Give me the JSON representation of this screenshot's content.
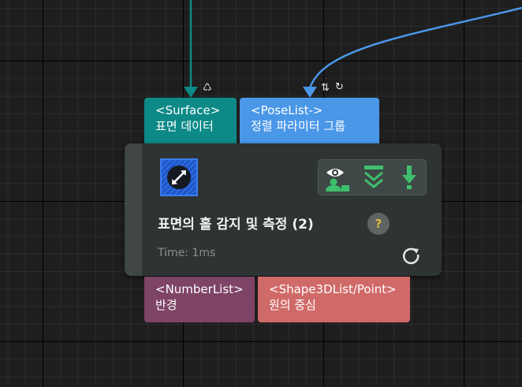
{
  "inputs": [
    {
      "type_tag": "<Surface>",
      "label": "표면 데이터",
      "color": "#0d8a87"
    },
    {
      "type_tag": "<PoseList->",
      "label": "정렬 파라미터 그룹",
      "color": "#4a97e8"
    }
  ],
  "outputs": [
    {
      "type_tag": "<NumberList>",
      "label": "반경",
      "color": "#7e4466"
    },
    {
      "type_tag": "<Shape3DList/Point>",
      "label": "원의 중심",
      "color": "#d06a68"
    }
  ],
  "port_icons": {
    "surface": "recycle-icon",
    "poselist": [
      "up-down-arrows-icon",
      "refresh-icon"
    ]
  },
  "node": {
    "title": "표면의 홀 감지 및 측정 (2)",
    "time": "Time: 1ms",
    "icon": "expand-diagonal-icon",
    "help_label": "?",
    "actions": [
      "eye-user-icon",
      "collapse-chevrons-icon",
      "download-arrow-icon"
    ],
    "accent_color": "#3fbf6e"
  },
  "connector_colors": {
    "surface": "#0d8a87",
    "poselist": "#4a97e8"
  }
}
